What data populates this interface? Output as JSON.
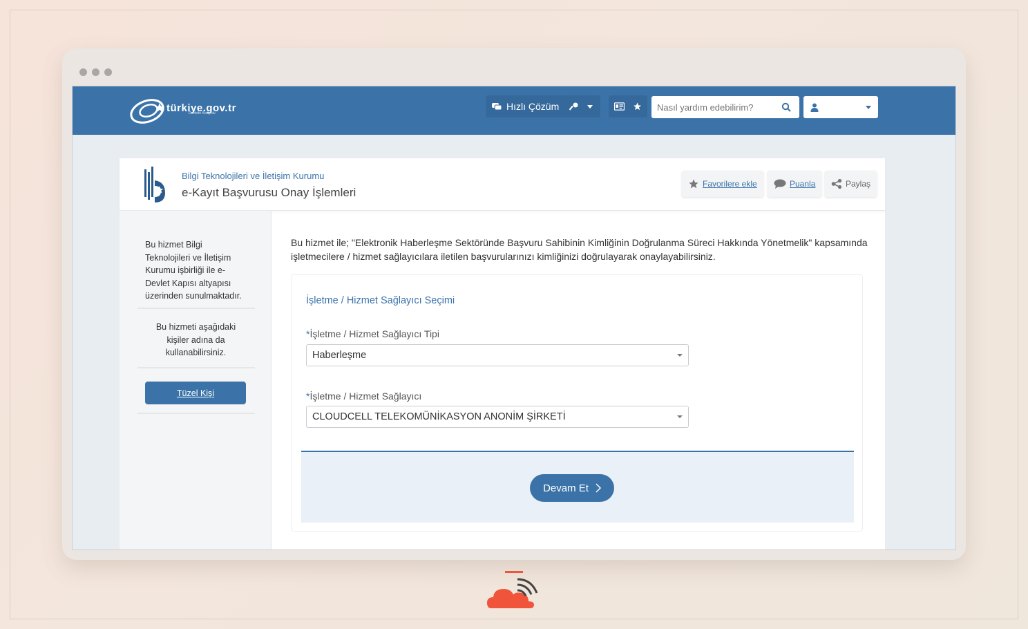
{
  "topbar": {
    "logo_text": "türkiye.gov.tr",
    "logo_sub": "Devletin Kısayolu",
    "quick_solution_label": "Hızlı Çözüm",
    "search_placeholder": "Nasıl yardım edebilirim?",
    "user_label": ""
  },
  "header": {
    "institution": "Bilgi Teknolojileri ve İletişim Kurumu",
    "service_title": "e-Kayıt Başvurusu Onay İşlemleri",
    "actions": {
      "favorite": "Favorilere ekle",
      "rate": "Puanla",
      "share": "Paylaş"
    }
  },
  "sidebar": {
    "info": "Bu hizmet Bilgi Teknolojileri ve İletişim Kurumu işbirliği ile e-Devlet Kapısı altyapısı üzerinden sunulmaktadır.",
    "usage": "Bu hizmeti aşağıdaki kişiler adına da kullanabilirsiniz.",
    "legal_entity_button": "Tüzel Kişi"
  },
  "main": {
    "description": "Bu hizmet ile; \"Elektronik Haberleşme Sektöründe Başvuru Sahibinin Kimliğinin Doğrulanma Süreci Hakkında Yönetmelik\" kapsamında işletmecilere / hizmet sağlayıcılara iletilen başvurularınızı kimliğinizi doğrulayarak onaylayabilirsiniz.",
    "section_title": "İşletme / Hizmet Sağlayıcı Seçimi",
    "field1": {
      "required_mark": "*",
      "label": "İşletme / Hizmet Sağlayıcı Tipi",
      "value": "Haberleşme"
    },
    "field2": {
      "required_mark": "*",
      "label": "İşletme / Hizmet Sağlayıcı",
      "value": "CLOUDCELL TELEKOMÜNİKASYON ANONİM ŞİRKETİ"
    },
    "continue_button": "Devam Et"
  },
  "colors": {
    "primary": "#3b73a9",
    "background": "#e8edf2",
    "brand_logo": "#f0543a"
  }
}
